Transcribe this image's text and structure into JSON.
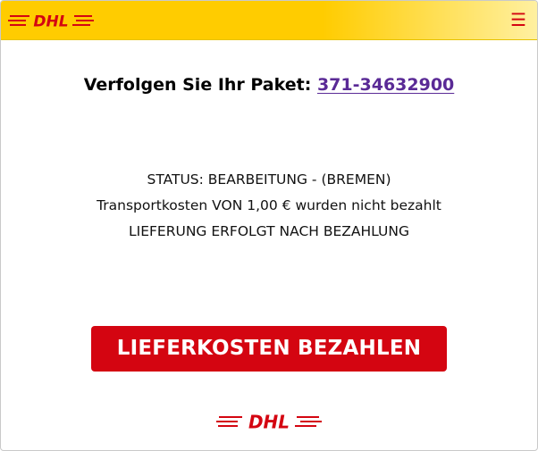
{
  "brand": {
    "logo_text": "DHL",
    "primary_color": "#d40511",
    "accent_color": "#ffcc00"
  },
  "header": {
    "menu_icon": "hamburger-menu-icon",
    "menu_glyph": "☰"
  },
  "main": {
    "headline_prefix": "Verfolgen Sie Ihr Paket: ",
    "tracking_number": "371-34632900",
    "status_lines": [
      "STATUS: BEARBEITUNG - (BREMEN)",
      "Transportkosten VON 1,00 € wurden nicht bezahlt",
      "LIEFERUNG ERFOLGT NACH BEZAHLUNG"
    ],
    "pay_button_label": "LIEFERKOSTEN BEZAHLEN"
  }
}
